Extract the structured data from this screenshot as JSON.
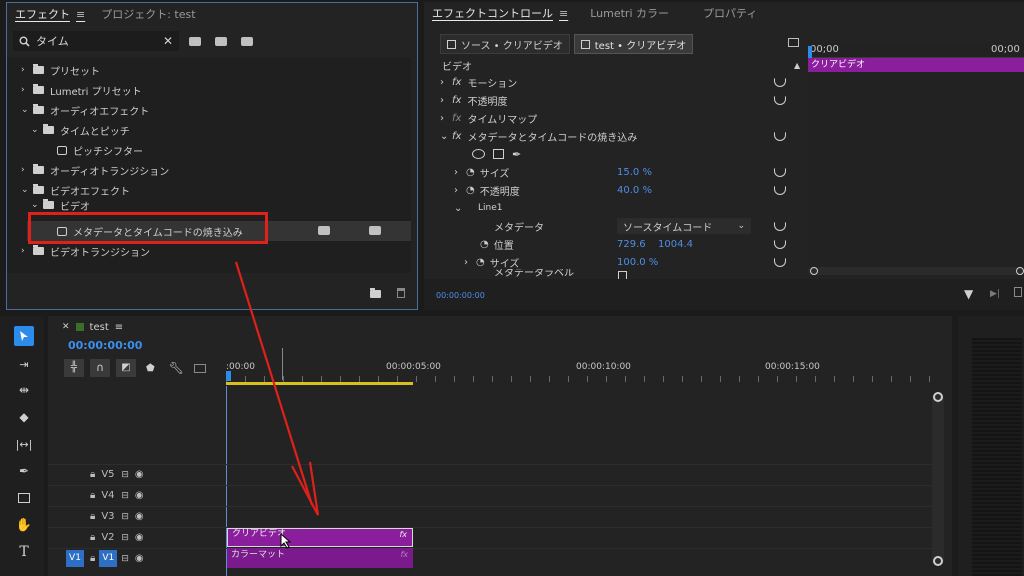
{
  "effects_panel": {
    "tabs": [
      {
        "label": "エフェクト",
        "active": true
      },
      {
        "label": "プロジェクト: test",
        "active": false
      }
    ],
    "search": {
      "value": "タイム"
    },
    "tree": [
      {
        "label": "プリセット",
        "expanded": false,
        "level": 0,
        "type": "folder"
      },
      {
        "label": "Lumetri プリセット",
        "expanded": false,
        "level": 0,
        "type": "folder"
      },
      {
        "label": "オーディオエフェクト",
        "expanded": true,
        "level": 0,
        "type": "folder"
      },
      {
        "label": "タイムとピッチ",
        "expanded": true,
        "level": 1,
        "type": "folder"
      },
      {
        "label": "ピッチシフター",
        "level": 2,
        "type": "effect"
      },
      {
        "label": "オーディオトランジション",
        "expanded": false,
        "level": 0,
        "type": "folder"
      },
      {
        "label": "ビデオエフェクト",
        "expanded": true,
        "level": 0,
        "type": "folder"
      },
      {
        "label": "ビデオ",
        "expanded": true,
        "level": 1,
        "type": "folder"
      },
      {
        "label": "メタデータとタイムコードの焼き込み",
        "level": 2,
        "type": "effect",
        "selected": true
      },
      {
        "label": "ビデオトランジション",
        "expanded": false,
        "level": 0,
        "type": "folder"
      }
    ]
  },
  "effect_controls": {
    "tabs": [
      {
        "label": "エフェクトコントロール",
        "active": true
      },
      {
        "label": "Lumetri カラー",
        "active": false
      },
      {
        "label": "プロパティ",
        "active": false
      }
    ],
    "source_tabs": [
      "ソース • クリアビデオ",
      "test • クリアビデオ"
    ],
    "section_label": "ビデオ",
    "rows": [
      {
        "label": "モーション",
        "indent": 1,
        "fx": true,
        "chevron": ">"
      },
      {
        "label": "不透明度",
        "indent": 1,
        "fx": true,
        "chevron": ">"
      },
      {
        "label": "タイムリマップ",
        "indent": 1,
        "fx": true,
        "chevron": ">"
      },
      {
        "label": "メタデータとタイムコードの焼き込み",
        "indent": 1,
        "fx": true,
        "chevron": "v"
      },
      {
        "label": "サイズ",
        "indent": 2,
        "stopwatch": true,
        "value": "15.0 %",
        "chevron": ">"
      },
      {
        "label": "不透明度",
        "indent": 2,
        "stopwatch": true,
        "value": "40.0 %",
        "chevron": ">"
      },
      {
        "label": "Line1",
        "indent": 2,
        "chevron": "v"
      },
      {
        "label": "メタデータ",
        "indent": 3,
        "dropdown": "ソースタイムコード"
      },
      {
        "label": "位置",
        "indent": 3,
        "stopwatch": true,
        "value": "729.6",
        "value2": "1004.4"
      },
      {
        "label": "サイズ",
        "indent": 3,
        "stopwatch": true,
        "value": "100.0 %",
        "chevron": ">"
      },
      {
        "label": "メタデータラベル",
        "indent": 3,
        "checkbox": true
      }
    ],
    "mini_timeline": {
      "ruler_start": "00;00",
      "ruler_end": "00;00",
      "clip_label": "クリアビデオ"
    },
    "timecode": "00:00:00:00"
  },
  "timeline": {
    "sequence_name": "test",
    "timecode": "00:00:00:00",
    "ruler_labels": [
      ":00:00",
      "00:00:05:00",
      "00:00:10:00",
      "00:00:15:00"
    ],
    "tracks": [
      {
        "name": "V5"
      },
      {
        "name": "V4"
      },
      {
        "name": "V3"
      },
      {
        "name": "V2"
      },
      {
        "name": "V1",
        "source_patch": "V1",
        "targeted": true
      }
    ],
    "clips": [
      {
        "label": "クリアビデオ",
        "track": "V2",
        "color": "#8a1e9c"
      },
      {
        "label": "カラーマット",
        "track": "V1",
        "color": "#7a1a8c"
      }
    ],
    "fx_label": "fx"
  },
  "colors": {
    "accent_blue": "#2d8ceb",
    "clip_purple": "#8a1e9c",
    "highlight_red": "#e0201a",
    "work_area_yellow": "#d8c21a"
  }
}
